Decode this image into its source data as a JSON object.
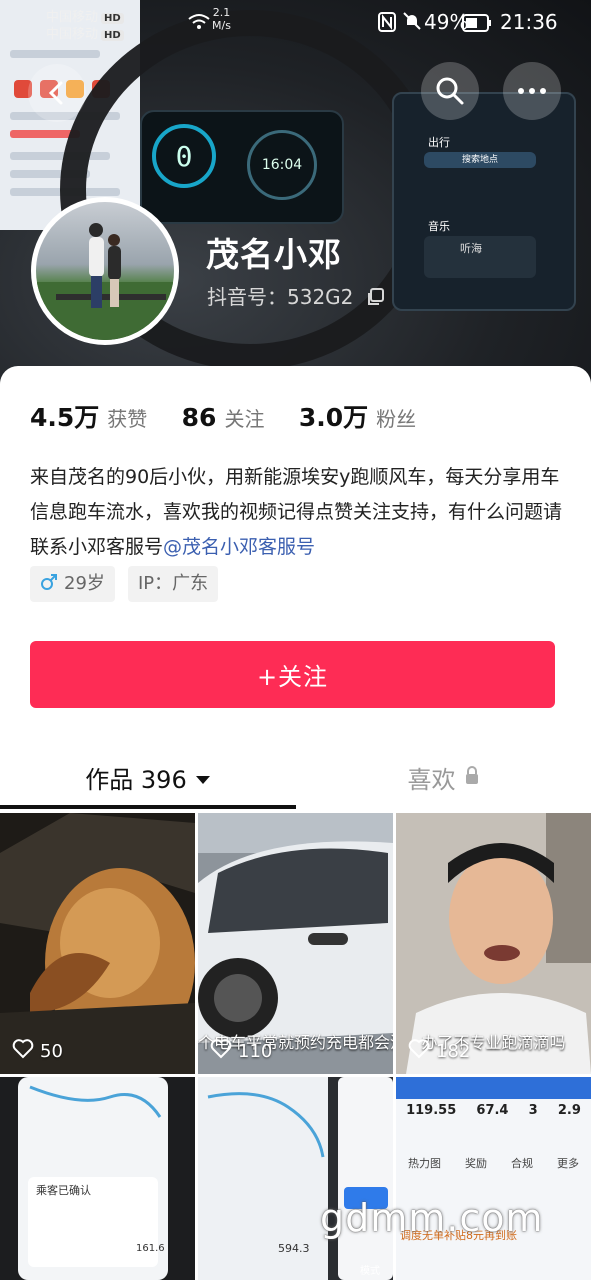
{
  "status_bar": {
    "carrier1": "中国移动",
    "carrier2": "中国移动",
    "hd1": "HD",
    "hd2": "HD",
    "net_speed": "2.1",
    "net_unit": "M/s",
    "battery": "49%",
    "time": "21:36"
  },
  "cover": {
    "cluster_speed": "0",
    "cluster_time": "16:04",
    "screen_header": "出行",
    "screen_nav": "搜索地点",
    "screen_music": "音乐",
    "screen_song": "听海"
  },
  "profile": {
    "name": "茂名小邓",
    "douyin_id_label": "抖音号：",
    "douyin_id": "532G2"
  },
  "stats": [
    {
      "value": "4.5万",
      "label": "获赞"
    },
    {
      "value": "86",
      "label": "关注"
    },
    {
      "value": "3.0万",
      "label": "粉丝"
    }
  ],
  "bio": {
    "text": "来自茂名的90后小伙，用新能源埃安y跑顺风车，每天分享用车信息跑车流水，喜欢我的视频记得点赞关注支持，有什么问题请联系小邓客服号",
    "mention": "@茂名小邓客服号"
  },
  "tags": {
    "age": "29岁",
    "ip": "IP：广东"
  },
  "follow_button": "+关注",
  "tabs": {
    "works": "作品 396",
    "likes": "喜欢"
  },
  "videos": [
    {
      "likes": "50",
      "caption": ""
    },
    {
      "likes": "110",
      "caption": "个电车平常就预约充电都会没电的"
    },
    {
      "likes": "182",
      "caption": "办了不专业跑滴滴吗"
    },
    {
      "likes": "",
      "caption": ""
    },
    {
      "likes": "",
      "caption": ""
    },
    {
      "likes": "",
      "caption": ""
    }
  ],
  "thumb_text": {
    "v4_a": "乘客已确认",
    "v4_b": "161.6",
    "v5_a": "594.3",
    "v5_b": "模式",
    "v6_stats": [
      "119.55",
      "67.4",
      "3",
      "2.9"
    ],
    "v6_menu": [
      "热力图",
      "奖励",
      "合规",
      "更多"
    ],
    "v6_notice": "调度无单补贴8元再到账"
  },
  "watermark": "gdmm.com",
  "colors": {
    "accent": "#fe2c55",
    "mention": "#3b5fb0"
  }
}
